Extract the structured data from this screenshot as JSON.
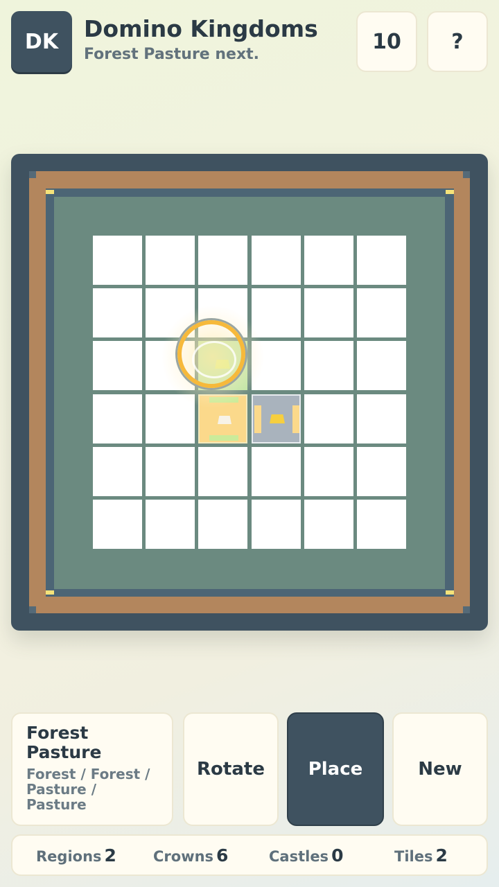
{
  "header": {
    "logo_text": "DK",
    "title": "Domino Kingdoms",
    "subtitle": "Forest Pasture next.",
    "score": "10",
    "help_label": "?"
  },
  "board": {
    "rows": 6,
    "cols": 6,
    "placed_tiles": [
      {
        "row": 3,
        "col": 2,
        "terrain": "pasture",
        "crowns": 1
      },
      {
        "row": 3,
        "col": 3,
        "terrain": "castle",
        "crowns": 0
      }
    ],
    "preview_tile": {
      "row": 2,
      "col": 2,
      "terrain": "forest"
    },
    "colors": {
      "frame": "#3f5260",
      "wall": "#b3865d",
      "moat": "#4c6575",
      "field": "#6b8a80",
      "empty_cell": "#ffffff",
      "forest": "#bfe5a5",
      "pasture": "#fbd98b",
      "castle": "#a9b3bd",
      "cursor": "#f6b93b"
    }
  },
  "current_piece": {
    "name": "Forest Pasture",
    "description": "Forest / Forest / Pasture / Pasture"
  },
  "actions": {
    "rotate_label": "Rotate",
    "place_label": "Place",
    "new_label": "New"
  },
  "stats": {
    "regions_label": "Regions",
    "regions_value": "2",
    "crowns_label": "Crowns",
    "crowns_value": "6",
    "castles_label": "Castles",
    "castles_value": "0",
    "tiles_label": "Tiles",
    "tiles_value": "2"
  }
}
